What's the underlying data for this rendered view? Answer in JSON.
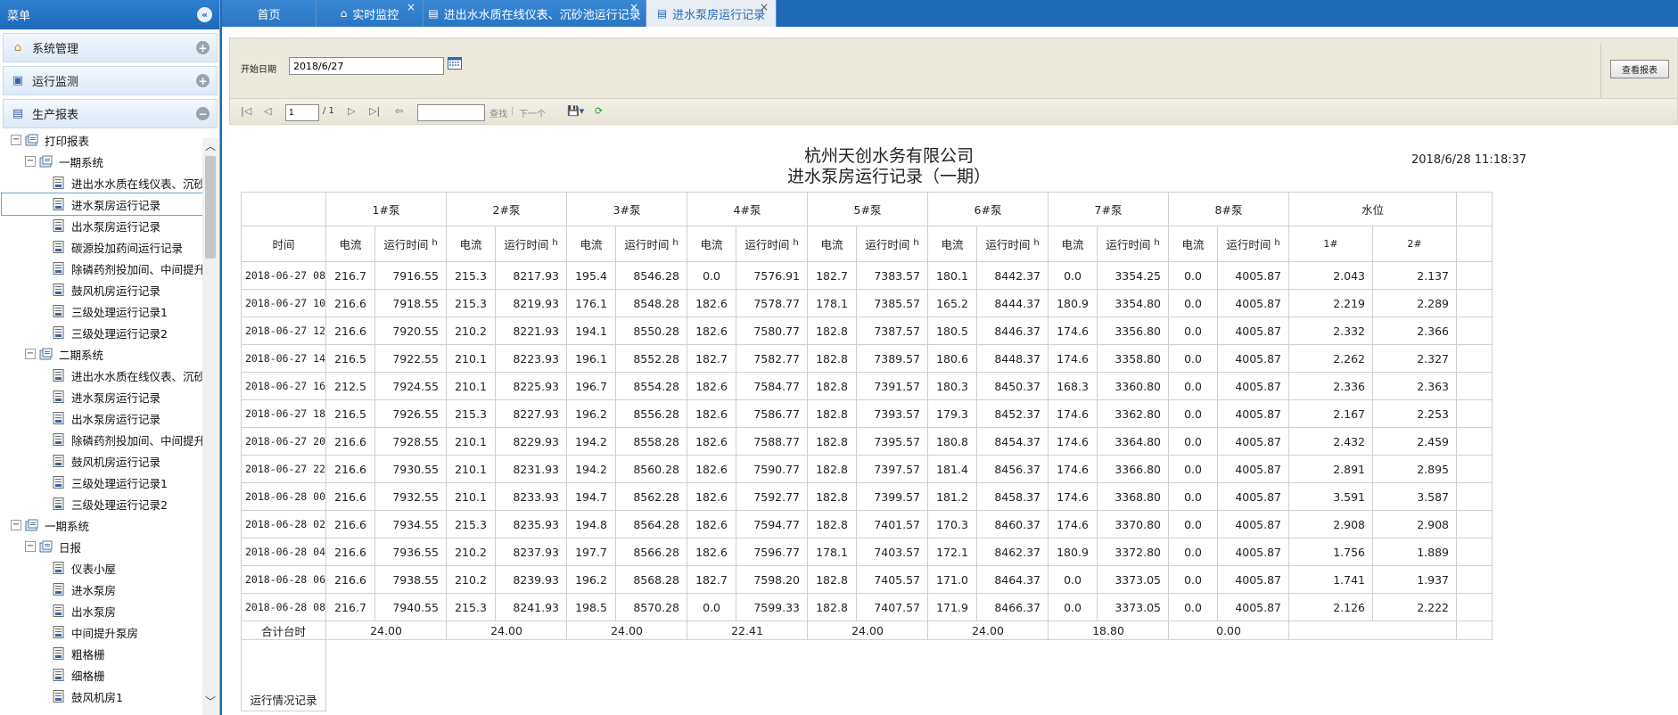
{
  "sidebar": {
    "title": "菜单",
    "accordions": [
      {
        "label": "系统管理",
        "icon": "home-icon",
        "toggle": "+"
      },
      {
        "label": "运行监测",
        "icon": "monitor-icon",
        "toggle": "+"
      },
      {
        "label": "生产报表",
        "icon": "report-icon",
        "toggle": "−"
      }
    ],
    "tree": [
      {
        "label": "打印报表",
        "level": 1,
        "type": "folder",
        "toggle": "−"
      },
      {
        "label": "一期系统",
        "level": 2,
        "type": "folder",
        "toggle": "−"
      },
      {
        "label": "进出水水质在线仪表、沉砂池运行记录",
        "level": 3,
        "type": "file"
      },
      {
        "label": "进水泵房运行记录",
        "level": 3,
        "type": "file",
        "selected": true
      },
      {
        "label": "出水泵房运行记录",
        "level": 3,
        "type": "file"
      },
      {
        "label": "碳源投加药间运行记录",
        "level": 3,
        "type": "file"
      },
      {
        "label": "除磷药剂投加间、中间提升泵房运行记录",
        "level": 3,
        "type": "file"
      },
      {
        "label": "鼓风机房运行记录",
        "level": 3,
        "type": "file"
      },
      {
        "label": "三级处理运行记录1",
        "level": 3,
        "type": "file"
      },
      {
        "label": "三级处理运行记录2",
        "level": 3,
        "type": "file"
      },
      {
        "label": "二期系统",
        "level": 2,
        "type": "folder",
        "toggle": "−"
      },
      {
        "label": "进出水水质在线仪表、沉砂池运行记录",
        "level": 3,
        "type": "file"
      },
      {
        "label": "进水泵房运行记录",
        "level": 3,
        "type": "file"
      },
      {
        "label": "出水泵房运行记录",
        "level": 3,
        "type": "file"
      },
      {
        "label": "除磷药剂投加间、中间提升泵房运行记录",
        "level": 3,
        "type": "file"
      },
      {
        "label": "鼓风机房运行记录",
        "level": 3,
        "type": "file"
      },
      {
        "label": "三级处理运行记录1",
        "level": 3,
        "type": "file"
      },
      {
        "label": "三级处理运行记录2",
        "level": 3,
        "type": "file"
      },
      {
        "label": "一期系统",
        "level": 1,
        "type": "folder",
        "toggle": "−"
      },
      {
        "label": "日报",
        "level": 2,
        "type": "folder",
        "toggle": "−"
      },
      {
        "label": "仪表小屋",
        "level": 3,
        "type": "file"
      },
      {
        "label": "进水泵房",
        "level": 3,
        "type": "file"
      },
      {
        "label": "出水泵房",
        "level": 3,
        "type": "file"
      },
      {
        "label": "中间提升泵房",
        "level": 3,
        "type": "file"
      },
      {
        "label": "粗格栅",
        "level": 3,
        "type": "file"
      },
      {
        "label": "细格栅",
        "level": 3,
        "type": "file"
      },
      {
        "label": "鼓风机房1",
        "level": 3,
        "type": "file"
      }
    ]
  },
  "tabs": [
    {
      "label": "首页",
      "closable": false,
      "active": false,
      "icon": ""
    },
    {
      "label": "实时监控",
      "closable": true,
      "active": false,
      "icon": "home-icon"
    },
    {
      "label": "进出水水质在线仪表、沉砂池运行记录",
      "closable": true,
      "active": false,
      "icon": "report-icon"
    },
    {
      "label": "进水泵房运行记录",
      "closable": true,
      "active": true,
      "icon": "report-icon"
    }
  ],
  "params": {
    "start_date_label": "开始日期",
    "start_date_value": "2018/6/27",
    "view_button": "查看报表"
  },
  "toolbar": {
    "page_value": "1",
    "page_total": "/ 1",
    "find_label": "查找",
    "next_label": "下一个"
  },
  "report": {
    "company": "杭州天创水务有限公司",
    "title": "进水泵房运行记录（一期）",
    "generated_at": "2018/6/28 11:18:37",
    "time_header": "时间",
    "pumps": [
      "1#泵",
      "2#泵",
      "3#泵",
      "4#泵",
      "5#泵",
      "6#泵",
      "7#泵",
      "8#泵"
    ],
    "level_header": "水位",
    "current_header": "电流",
    "runtime_header": "运行时间",
    "runtime_unit": "h",
    "level_cols": [
      "1#",
      "2#"
    ],
    "rows": [
      {
        "time": "2018-06-27 08",
        "v": [
          "216.7",
          "7916.55",
          "215.3",
          "8217.93",
          "195.4",
          "8546.28",
          "0.0",
          "7576.91",
          "182.7",
          "7383.57",
          "180.1",
          "8442.37",
          "0.0",
          "3354.25",
          "0.0",
          "4005.87",
          "2.043",
          "2.137"
        ]
      },
      {
        "time": "2018-06-27 10",
        "v": [
          "216.6",
          "7918.55",
          "215.3",
          "8219.93",
          "176.1",
          "8548.28",
          "182.6",
          "7578.77",
          "178.1",
          "7385.57",
          "165.2",
          "8444.37",
          "180.9",
          "3354.80",
          "0.0",
          "4005.87",
          "2.219",
          "2.289"
        ]
      },
      {
        "time": "2018-06-27 12",
        "v": [
          "216.6",
          "7920.55",
          "210.2",
          "8221.93",
          "194.1",
          "8550.28",
          "182.6",
          "7580.77",
          "182.8",
          "7387.57",
          "180.5",
          "8446.37",
          "174.6",
          "3356.80",
          "0.0",
          "4005.87",
          "2.332",
          "2.366"
        ]
      },
      {
        "time": "2018-06-27 14",
        "v": [
          "216.5",
          "7922.55",
          "210.1",
          "8223.93",
          "196.1",
          "8552.28",
          "182.7",
          "7582.77",
          "182.8",
          "7389.57",
          "180.6",
          "8448.37",
          "174.6",
          "3358.80",
          "0.0",
          "4005.87",
          "2.262",
          "2.327"
        ]
      },
      {
        "time": "2018-06-27 16",
        "v": [
          "212.5",
          "7924.55",
          "210.1",
          "8225.93",
          "196.7",
          "8554.28",
          "182.6",
          "7584.77",
          "182.8",
          "7391.57",
          "180.3",
          "8450.37",
          "168.3",
          "3360.80",
          "0.0",
          "4005.87",
          "2.336",
          "2.363"
        ]
      },
      {
        "time": "2018-06-27 18",
        "v": [
          "216.5",
          "7926.55",
          "215.3",
          "8227.93",
          "196.2",
          "8556.28",
          "182.6",
          "7586.77",
          "182.8",
          "7393.57",
          "179.3",
          "8452.37",
          "174.6",
          "3362.80",
          "0.0",
          "4005.87",
          "2.167",
          "2.253"
        ]
      },
      {
        "time": "2018-06-27 20",
        "v": [
          "216.6",
          "7928.55",
          "210.1",
          "8229.93",
          "194.2",
          "8558.28",
          "182.6",
          "7588.77",
          "182.8",
          "7395.57",
          "180.8",
          "8454.37",
          "174.6",
          "3364.80",
          "0.0",
          "4005.87",
          "2.432",
          "2.459"
        ]
      },
      {
        "time": "2018-06-27 22",
        "v": [
          "216.6",
          "7930.55",
          "210.1",
          "8231.93",
          "194.2",
          "8560.28",
          "182.6",
          "7590.77",
          "182.8",
          "7397.57",
          "181.4",
          "8456.37",
          "174.6",
          "3366.80",
          "0.0",
          "4005.87",
          "2.891",
          "2.895"
        ]
      },
      {
        "time": "2018-06-28 00",
        "v": [
          "216.6",
          "7932.55",
          "210.1",
          "8233.93",
          "194.7",
          "8562.28",
          "182.6",
          "7592.77",
          "182.8",
          "7399.57",
          "181.2",
          "8458.37",
          "174.6",
          "3368.80",
          "0.0",
          "4005.87",
          "3.591",
          "3.587"
        ]
      },
      {
        "time": "2018-06-28 02",
        "v": [
          "216.6",
          "7934.55",
          "215.3",
          "8235.93",
          "194.8",
          "8564.28",
          "182.6",
          "7594.77",
          "182.8",
          "7401.57",
          "170.3",
          "8460.37",
          "174.6",
          "3370.80",
          "0.0",
          "4005.87",
          "2.908",
          "2.908"
        ]
      },
      {
        "time": "2018-06-28 04",
        "v": [
          "216.6",
          "7936.55",
          "210.2",
          "8237.93",
          "197.7",
          "8566.28",
          "182.6",
          "7596.77",
          "178.1",
          "7403.57",
          "172.1",
          "8462.37",
          "180.9",
          "3372.80",
          "0.0",
          "4005.87",
          "1.756",
          "1.889"
        ]
      },
      {
        "time": "2018-06-28 06",
        "v": [
          "216.6",
          "7938.55",
          "210.2",
          "8239.93",
          "196.2",
          "8568.28",
          "182.7",
          "7598.20",
          "182.8",
          "7405.57",
          "171.0",
          "8464.37",
          "0.0",
          "3373.05",
          "0.0",
          "4005.87",
          "1.741",
          "1.937"
        ]
      },
      {
        "time": "2018-06-28 08",
        "v": [
          "216.7",
          "7940.55",
          "215.3",
          "8241.93",
          "198.5",
          "8570.28",
          "0.0",
          "7599.33",
          "182.8",
          "7407.57",
          "171.9",
          "8466.37",
          "0.0",
          "3373.05",
          "0.0",
          "4005.87",
          "2.126",
          "2.222"
        ]
      }
    ],
    "total_label": "合计台时",
    "totals": [
      "24.00",
      "24.00",
      "24.00",
      "22.41",
      "24.00",
      "24.00",
      "18.80",
      "0.00"
    ],
    "note_label": "运行情况记录"
  }
}
